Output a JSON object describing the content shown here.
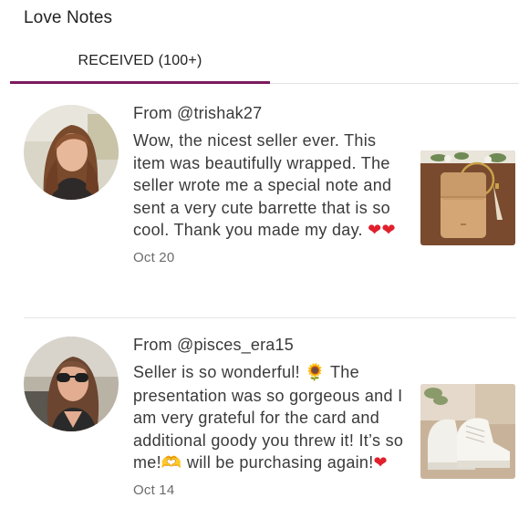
{
  "header": {
    "title": "Love Notes"
  },
  "tabs": [
    {
      "label": "RECEIVED (100+)",
      "active": true
    }
  ],
  "accent_color": "#7b1b5e",
  "notes": [
    {
      "from": "From @trishak27",
      "text_parts": [
        "Wow, the nicest seller ever. This item was beautifully wrapped. The seller wrote me a special note and sent a very cute barrette that is so cool. Thank you made my day. ",
        "❤❤"
      ],
      "date": "Oct 20",
      "avatar_icon": "user-avatar",
      "thumbnail_icon": "tan-leather-wristlet-product-photo"
    },
    {
      "from": "From @pisces_era15",
      "text_parts": [
        "Seller is so wonderful! ",
        "🌻",
        " The presentation was so gorgeous and I am very grateful for the card and additional goody you threw it! It’s so me!",
        "🫶",
        " will be purchasing again!",
        "❤"
      ],
      "date": "Oct 14",
      "avatar_icon": "user-avatar",
      "thumbnail_icon": "white-sneakers-product-photo"
    }
  ]
}
